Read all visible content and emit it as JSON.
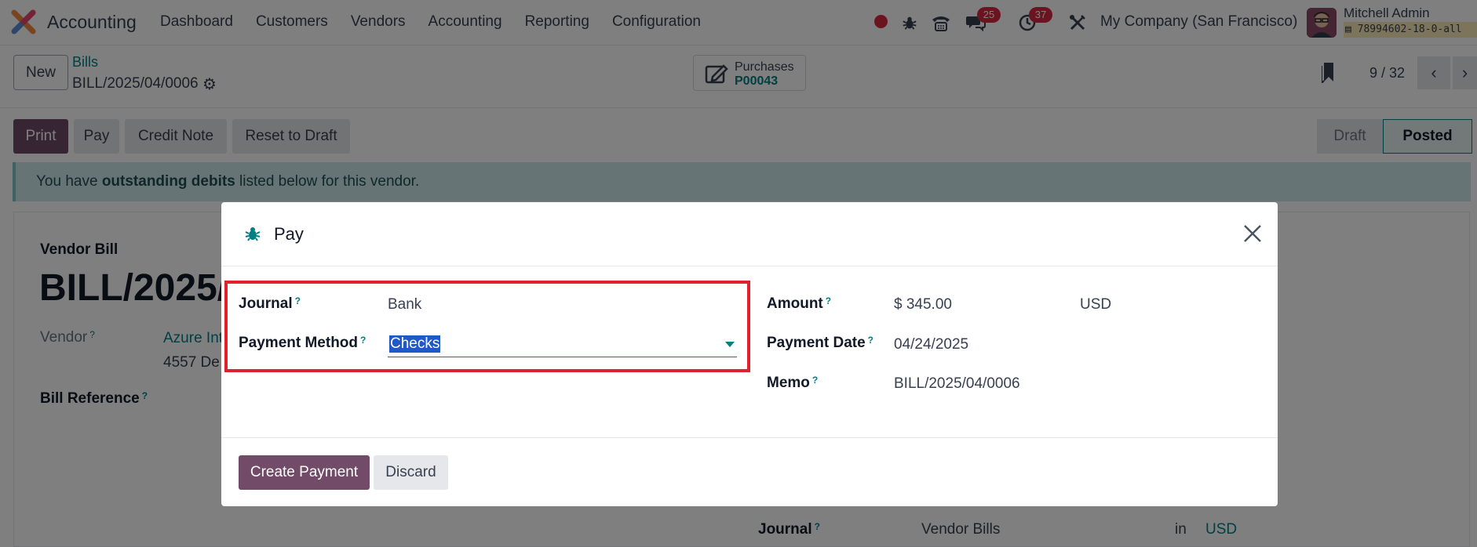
{
  "navbar": {
    "app_name": "Accounting",
    "menu": [
      "Dashboard",
      "Customers",
      "Vendors",
      "Accounting",
      "Reporting",
      "Configuration"
    ],
    "messages_count": "25",
    "activities_count": "37",
    "company": "My Company (San Francisco)",
    "user_name": "Mitchell Admin",
    "database": "78994602-18-0-all"
  },
  "control": {
    "new_label": "New",
    "breadcrumb": "Bills",
    "record": "BILL/2025/04/0006",
    "smart_button": {
      "label": "Purchases",
      "value": "P00043"
    },
    "pager": "9 / 32"
  },
  "actions": {
    "print": "Print",
    "pay": "Pay",
    "credit_note": "Credit Note",
    "reset": "Reset to Draft",
    "status": [
      "Draft",
      "Posted"
    ],
    "status_active": "Posted"
  },
  "alert": {
    "pre": "You have ",
    "bold": "outstanding debits",
    "post": " listed below for this vendor."
  },
  "form": {
    "doc_type": "Vendor Bill",
    "doc_title": "BILL/2025/0",
    "vendor_label": "Vendor",
    "vendor_value": "Azure Int",
    "vendor_address": "4557 De",
    "bill_ref_label": "Bill Reference",
    "journal_label": "Journal",
    "journal_value": "Vendor Bills",
    "in_label": "in",
    "currency": "USD"
  },
  "modal": {
    "title": "Pay",
    "fields_left": [
      {
        "label": "Journal",
        "value": "Bank"
      },
      {
        "label": "Payment Method",
        "value": "Checks"
      }
    ],
    "fields_right": [
      {
        "label": "Amount",
        "value": "$ 345.00",
        "currency": "USD"
      },
      {
        "label": "Payment Date",
        "value": "04/24/2025"
      },
      {
        "label": "Memo",
        "value": "BILL/2025/04/0006"
      }
    ],
    "create_label": "Create Payment",
    "discard_label": "Discard"
  },
  "colors": {
    "brand": "#714b67",
    "accent": "#017e84",
    "highlight": "#e0202d",
    "badge": "#d6293e"
  }
}
